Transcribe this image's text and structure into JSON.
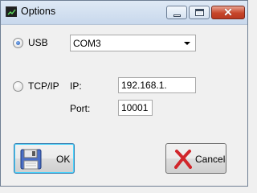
{
  "window": {
    "title": "Options"
  },
  "titlebar": {
    "minimize_icon": "minimize-icon",
    "maximize_icon": "maximize-icon",
    "close_glyph": "✕"
  },
  "connection": {
    "usb_label": "USB",
    "usb_selected": true,
    "port_select_value": "COM3",
    "tcpip_label": "TCP/IP",
    "tcpip_selected": false,
    "ip_label": "IP:",
    "ip_value": "192.168.1.",
    "port_label": "Port:",
    "port_value": "10001"
  },
  "buttons": {
    "ok_label": "OK",
    "ok_icon": "floppy-disk-icon",
    "cancel_label": "Cancel",
    "cancel_icon": "red-x-icon"
  },
  "colors": {
    "close_button": "#c7462b",
    "default_button_border": "#3c7fb1",
    "cancel_x": "#d1262b"
  }
}
